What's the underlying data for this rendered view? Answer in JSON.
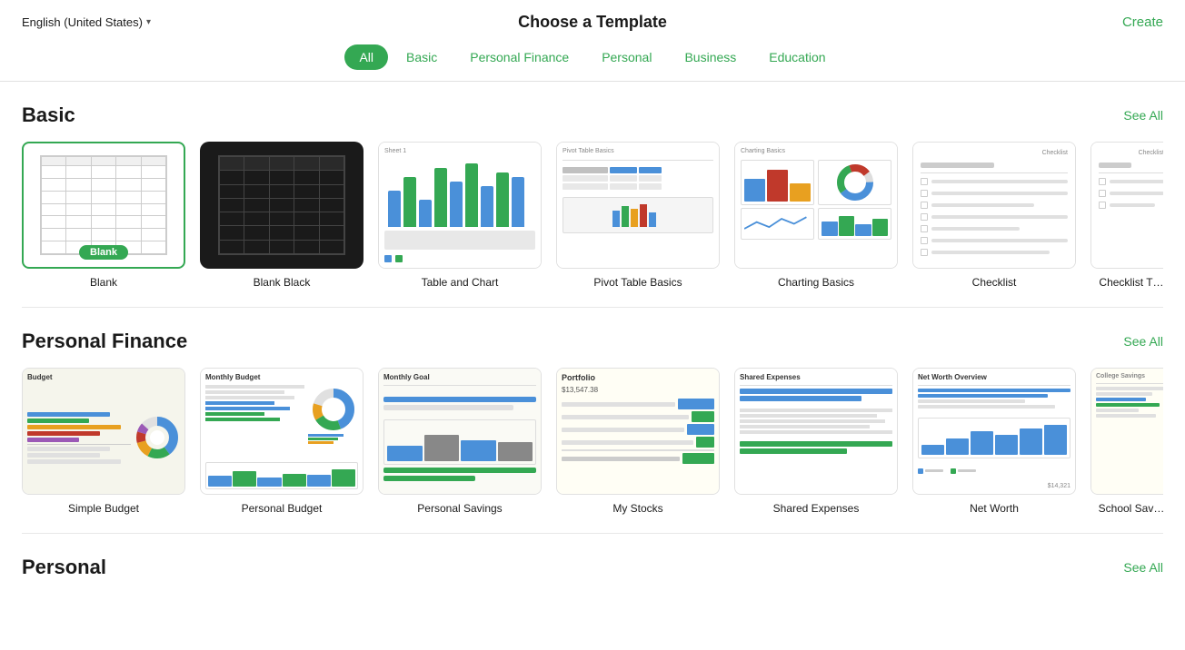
{
  "header": {
    "lang_label": "English (United States)",
    "title": "Choose a Template",
    "create_label": "Create"
  },
  "nav": {
    "tabs": [
      {
        "label": "All",
        "active": true
      },
      {
        "label": "Basic",
        "active": false
      },
      {
        "label": "Personal Finance",
        "active": false
      },
      {
        "label": "Personal",
        "active": false
      },
      {
        "label": "Business",
        "active": false
      },
      {
        "label": "Education",
        "active": false
      }
    ]
  },
  "sections": {
    "basic": {
      "title": "Basic",
      "see_all": "See All",
      "templates": [
        {
          "label": "Blank",
          "badge": "Blank",
          "selected": true
        },
        {
          "label": "Blank Black",
          "selected": false
        },
        {
          "label": "Table and Chart",
          "selected": false
        },
        {
          "label": "Pivot Table Basics",
          "selected": false
        },
        {
          "label": "Charting Basics",
          "selected": false
        },
        {
          "label": "Checklist",
          "selected": false
        },
        {
          "label": "Checklist",
          "partial": true,
          "selected": false
        }
      ]
    },
    "personal_finance": {
      "title": "Personal Finance",
      "see_all": "See All",
      "templates": [
        {
          "label": "Simple Budget",
          "selected": false
        },
        {
          "label": "Personal Budget",
          "selected": false
        },
        {
          "label": "Personal Savings",
          "selected": false
        },
        {
          "label": "My Stocks",
          "selected": false
        },
        {
          "label": "Shared Expenses",
          "selected": false
        },
        {
          "label": "Net Worth",
          "selected": false
        },
        {
          "label": "School Sav…",
          "partial": true,
          "selected": false
        }
      ]
    },
    "personal": {
      "title": "Personal",
      "see_all": "See All"
    }
  }
}
